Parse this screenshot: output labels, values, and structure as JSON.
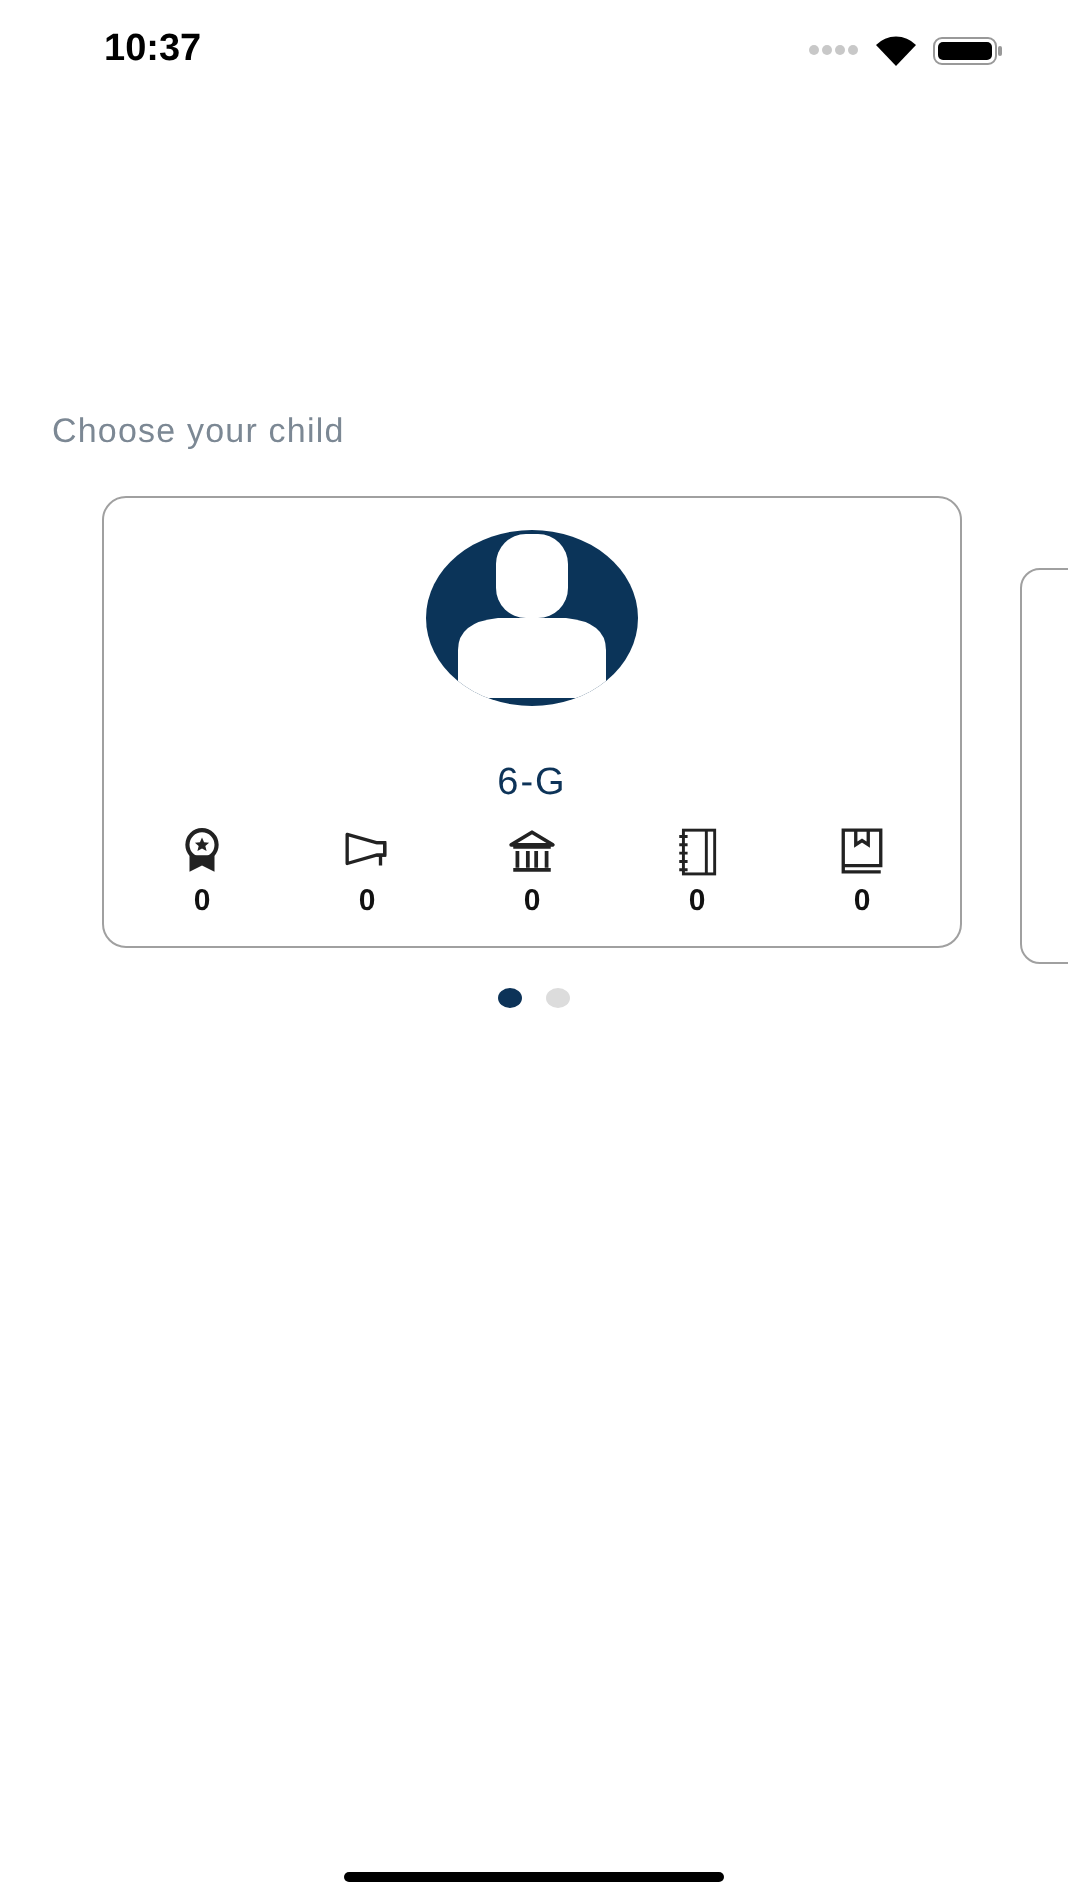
{
  "status_bar": {
    "time": "10:37"
  },
  "heading": "Choose your child",
  "cards": [
    {
      "class_name": "6-G",
      "stats": [
        {
          "kind": "award",
          "value": "0"
        },
        {
          "kind": "announcement",
          "value": "0"
        },
        {
          "kind": "building",
          "value": "0"
        },
        {
          "kind": "notebook",
          "value": "0"
        },
        {
          "kind": "book",
          "value": "0"
        }
      ]
    }
  ],
  "pager": [
    {
      "selected": true
    },
    {
      "selected": false
    }
  ]
}
